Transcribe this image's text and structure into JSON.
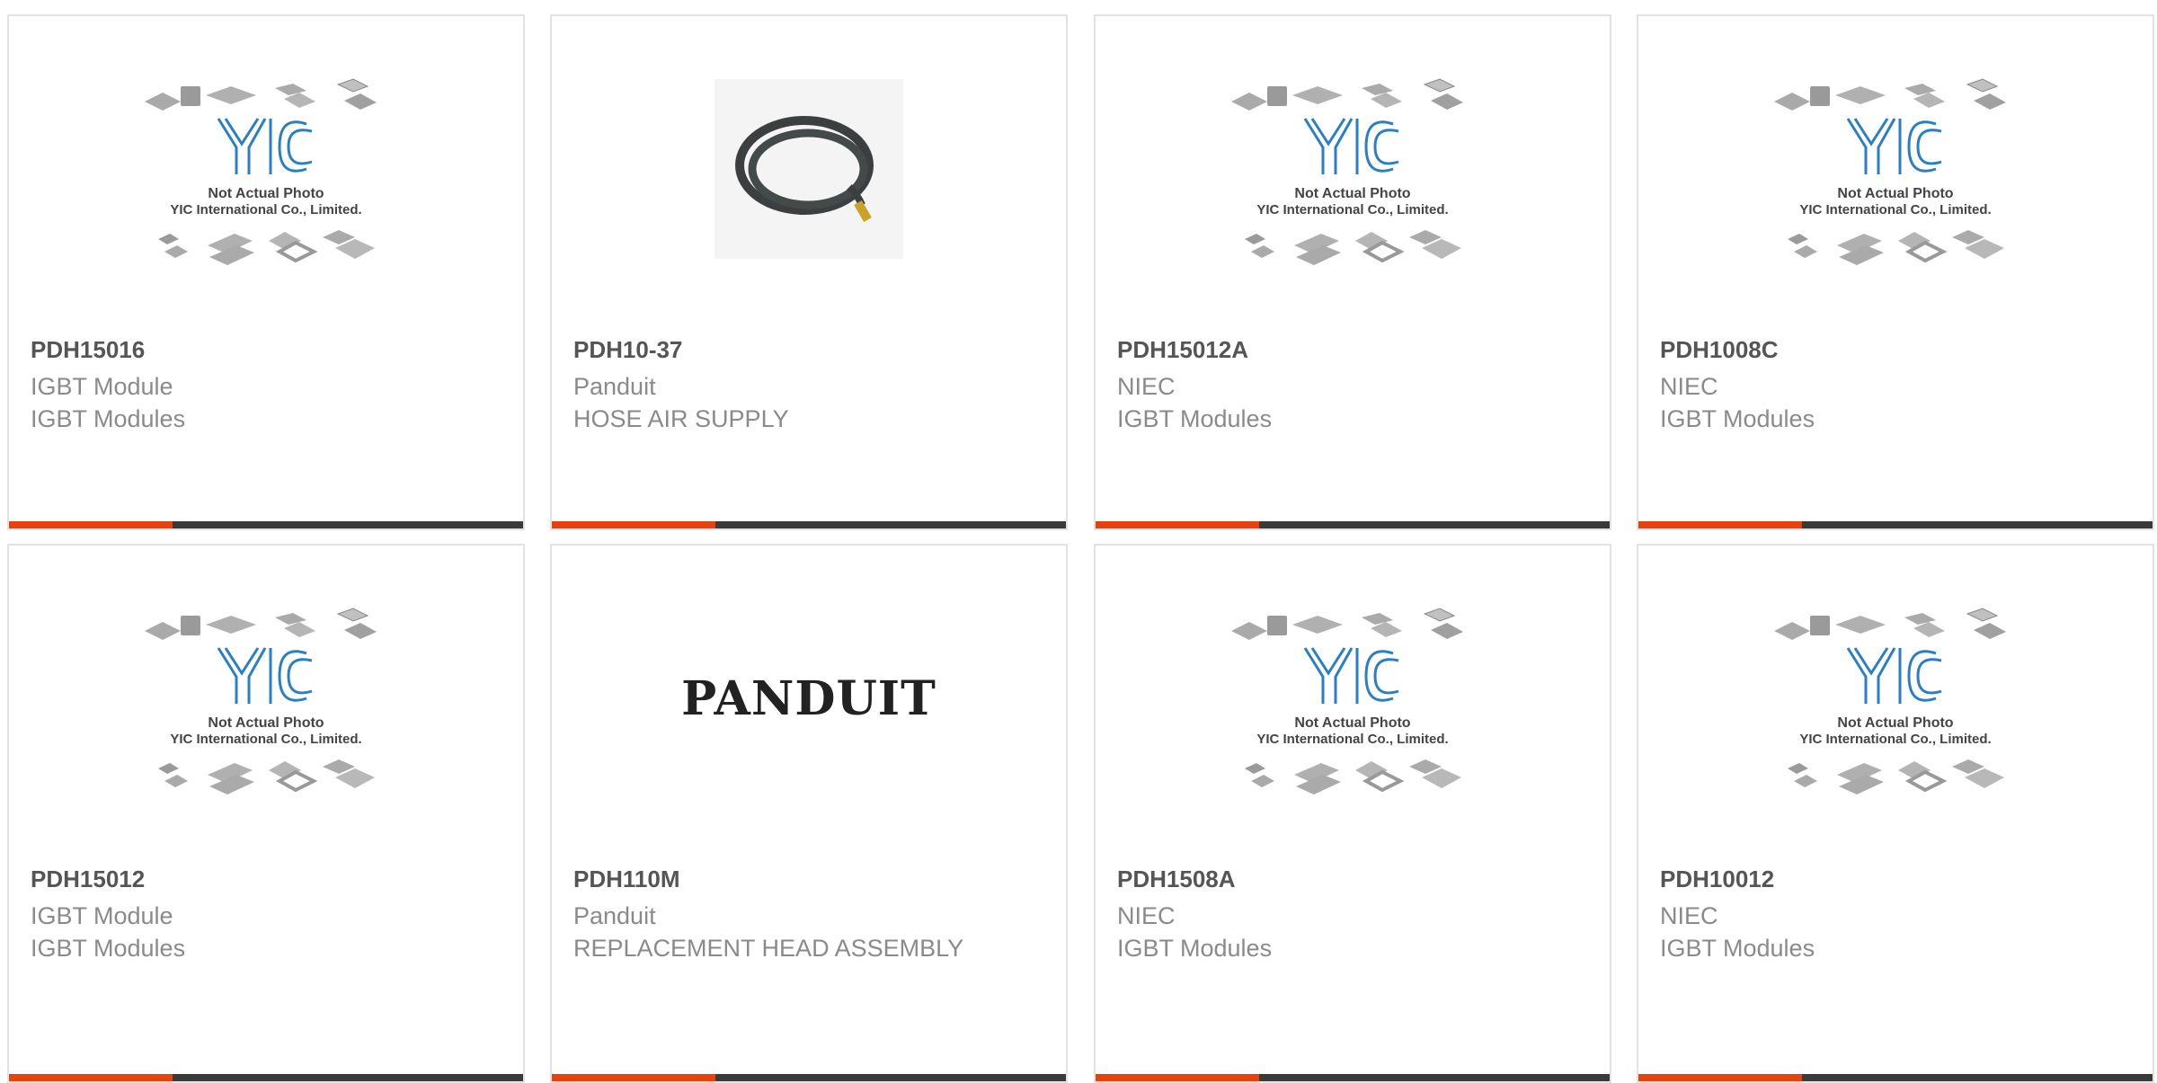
{
  "placeholder": {
    "line1": "Not Actual Photo",
    "line2": "YIC International Co., Limited.",
    "logo": "YIC"
  },
  "brand_logo": "PANDUIT",
  "products": [
    {
      "part": "PDH15016",
      "manufacturer": "IGBT Module",
      "description": "IGBT Modules",
      "image": "yic-placeholder"
    },
    {
      "part": "PDH10-37",
      "manufacturer": "Panduit",
      "description": "HOSE AIR SUPPLY",
      "image": "air-hose-photo"
    },
    {
      "part": "PDH15012A",
      "manufacturer": "NIEC",
      "description": "IGBT Modules",
      "image": "yic-placeholder"
    },
    {
      "part": "PDH1008C",
      "manufacturer": "NIEC",
      "description": "IGBT Modules",
      "image": "yic-placeholder"
    },
    {
      "part": "PDH15012",
      "manufacturer": "IGBT Module",
      "description": "IGBT Modules",
      "image": "yic-placeholder"
    },
    {
      "part": "PDH110M",
      "manufacturer": "Panduit",
      "description": "REPLACEMENT HEAD ASSEMBLY",
      "image": "panduit-logo"
    },
    {
      "part": "PDH1508A",
      "manufacturer": "NIEC",
      "description": "IGBT Modules",
      "image": "yic-placeholder"
    },
    {
      "part": "PDH10012",
      "manufacturer": "NIEC",
      "description": "IGBT Modules",
      "image": "yic-placeholder"
    }
  ],
  "colors": {
    "accent": "#e8410e",
    "bar": "#3a3a3a",
    "logo_blue": "#2a7fc4"
  }
}
